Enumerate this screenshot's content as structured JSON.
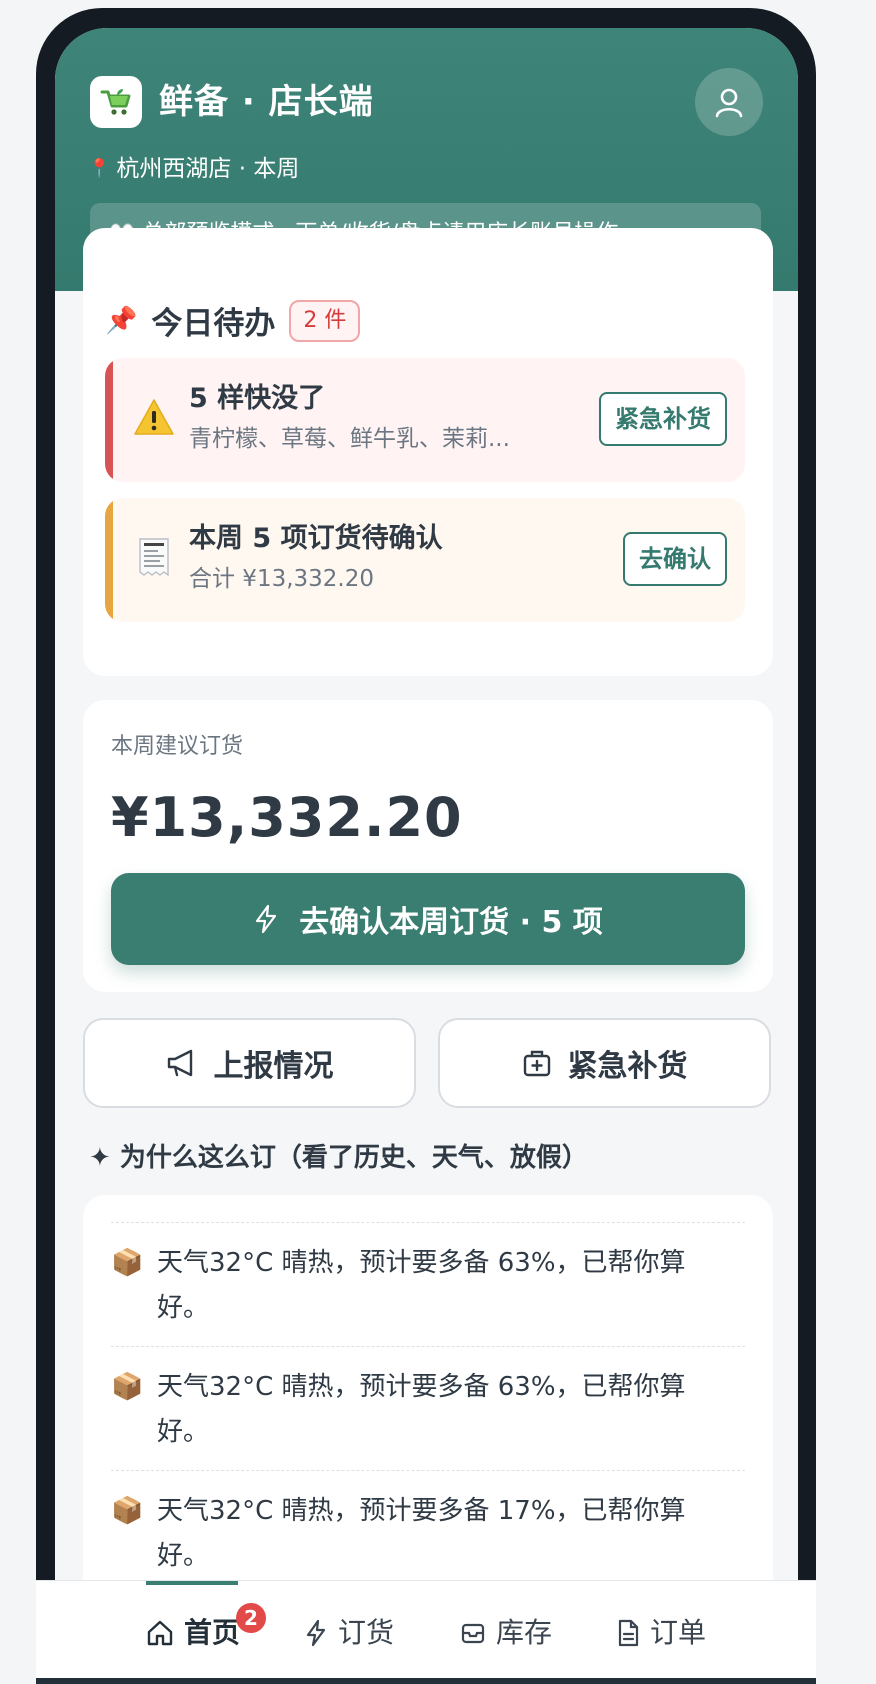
{
  "colors": {
    "brand": "#3a7d71",
    "header_bg": "#3e8478",
    "urgent_stripe": "#d85454",
    "order_stripe": "#e8a640",
    "badge_red": "#e24a4a"
  },
  "header": {
    "app_title": "鲜备 · 店长端",
    "location": "杭州西湖店 · 本周",
    "preview_notice": "👀 总部预览模式 · 下单/收货/盘点请用店长账号操作",
    "logo_icon": "cart-icon",
    "avatar_icon": "user-icon"
  },
  "todo": {
    "title": "今日待办",
    "count_badge": "2 件",
    "items": [
      {
        "title": "5 样快没了",
        "subtitle": "青柠檬、草莓、鲜牛乳、茉莉...",
        "action": "紧急补货",
        "icon": "warning-icon"
      },
      {
        "title": "本周 5 项订货待确认",
        "subtitle": "合计 ¥13,332.20",
        "action": "去确认",
        "icon": "receipt-icon"
      }
    ]
  },
  "weekly": {
    "label": "本周建议订货",
    "amount": "¥13,332.20",
    "confirm_label": "去确认本周订货 · 5 项"
  },
  "actions": {
    "report_label": "上报情况",
    "restock_label": "紧急补货"
  },
  "why": {
    "title": "✦ 为什么这么订（看了历史、天气、放假）",
    "reasons": [
      {
        "line1": "天气32°C 晴热，预计要多备 63%，已帮你算",
        "line2": "好。"
      },
      {
        "line1": "天气32°C 晴热，预计要多备 63%，已帮你算",
        "line2": "好。"
      },
      {
        "line1": "天气32°C 晴热，预计要多备 17%，已帮你算",
        "line2": "好。"
      }
    ]
  },
  "nav": {
    "home": "首页",
    "home_badge": "2",
    "order": "订货",
    "stock": "库存",
    "orders": "订单"
  }
}
